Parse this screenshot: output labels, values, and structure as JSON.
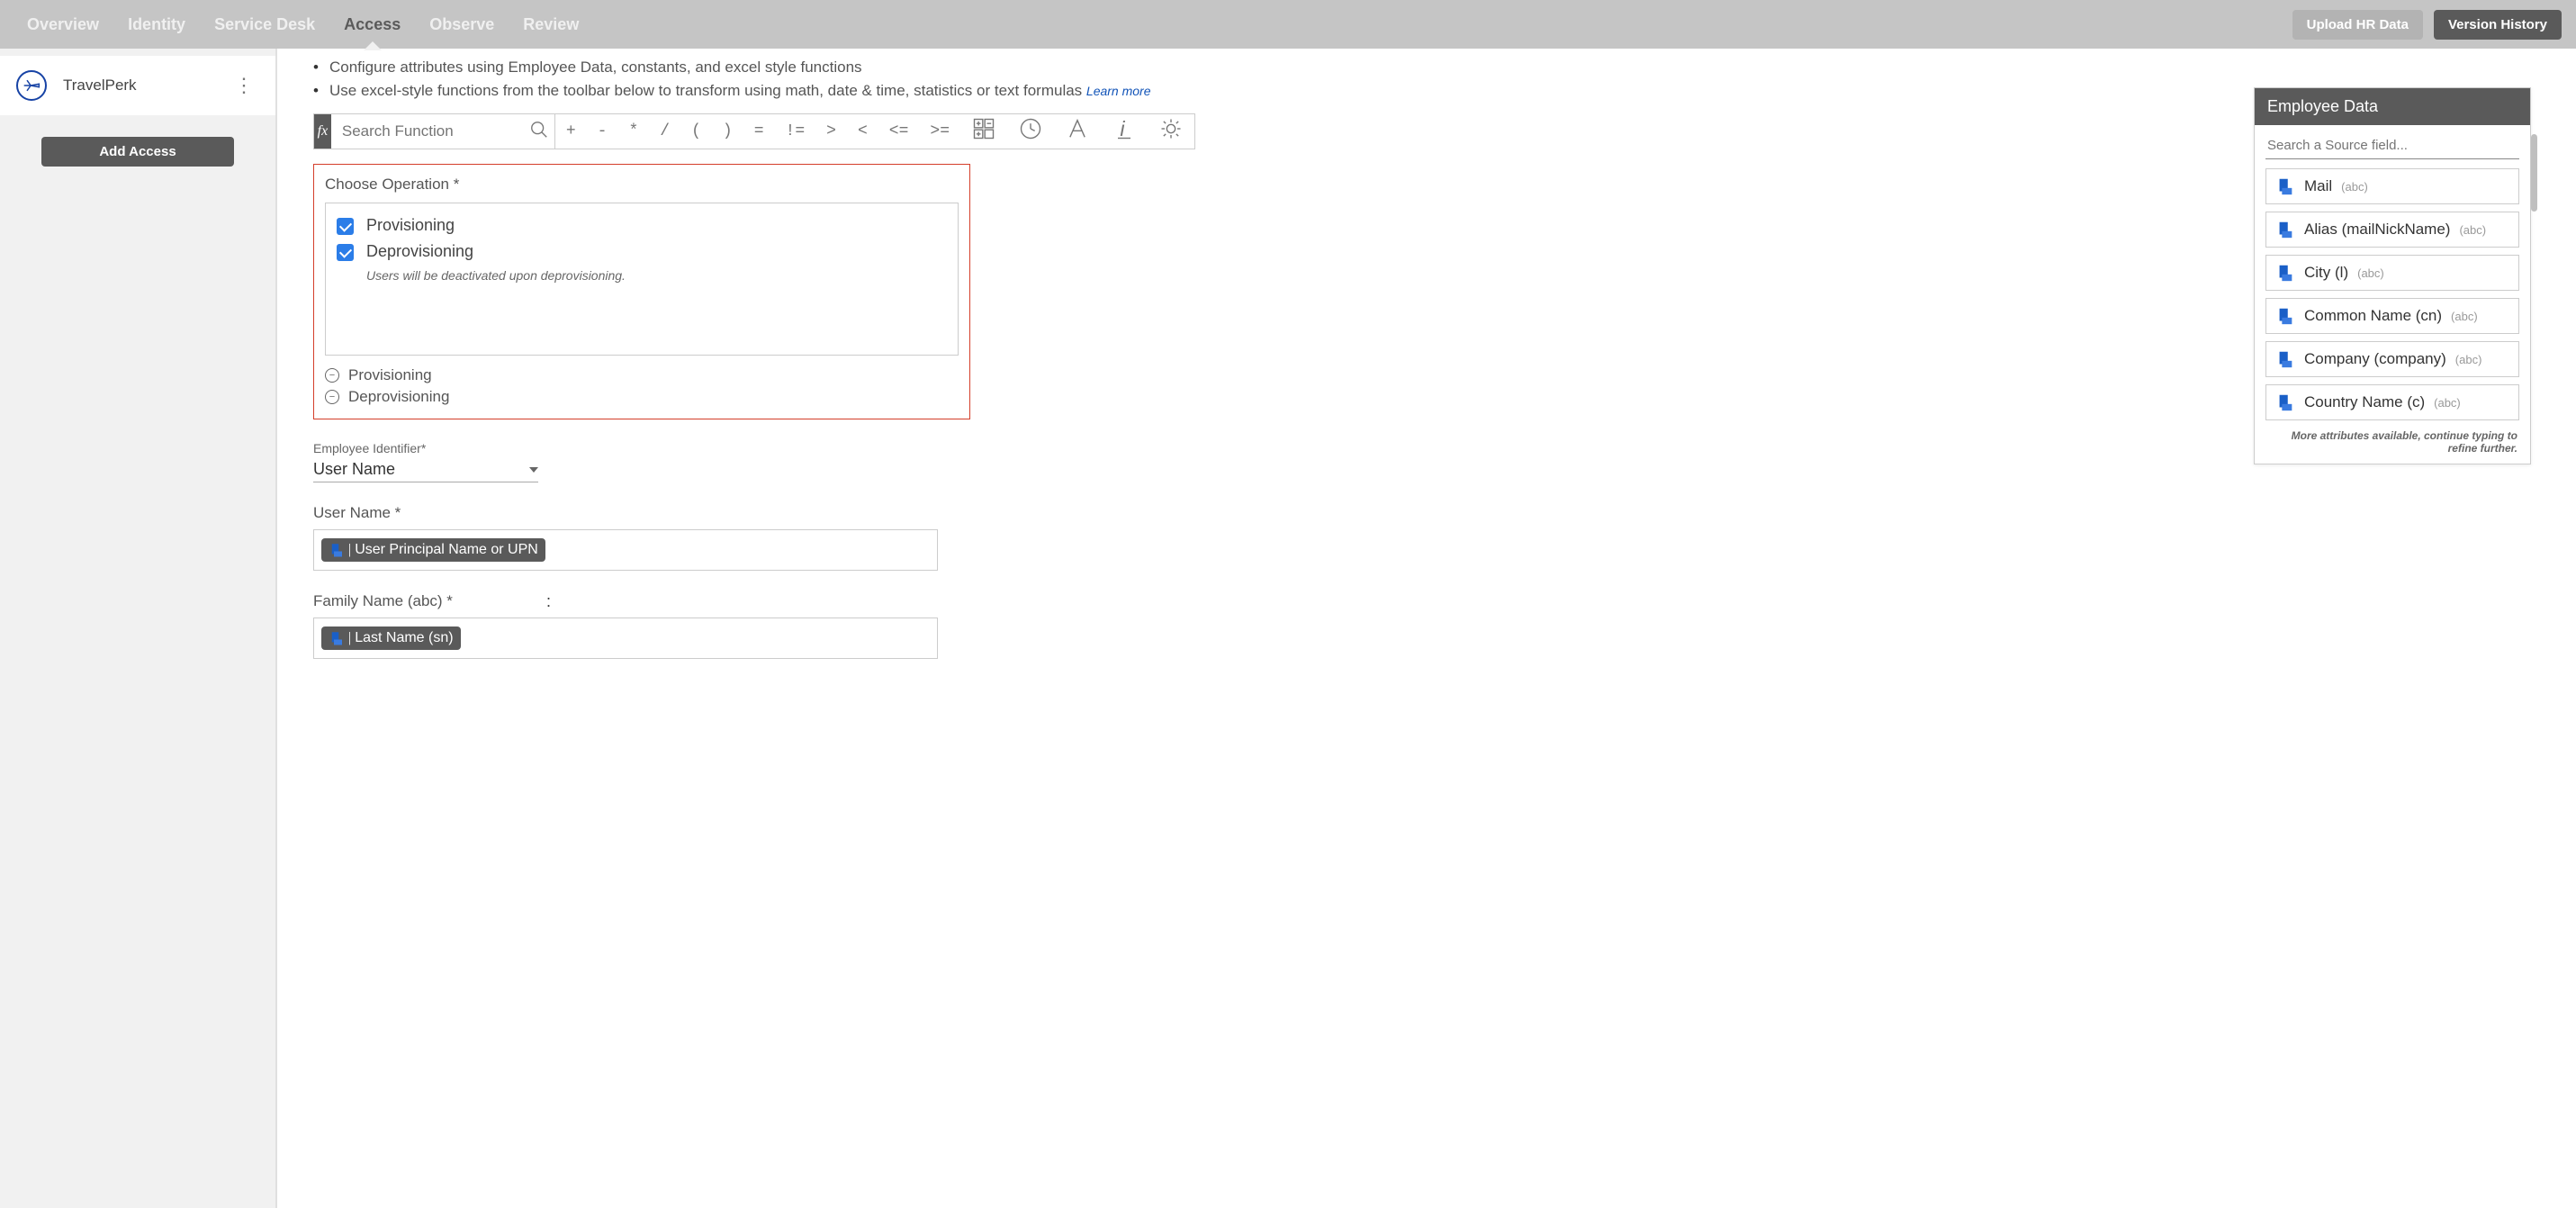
{
  "topnav": {
    "tabs": [
      "Overview",
      "Identity",
      "Service Desk",
      "Access",
      "Observe",
      "Review"
    ],
    "active_tab": "Access",
    "upload_label": "Upload HR Data",
    "version_label": "Version History"
  },
  "sidebar": {
    "app_name": "TravelPerk",
    "add_access_label": "Add Access"
  },
  "main": {
    "bullets": [
      "Configure attributes using Employee Data, constants, and excel style functions",
      "Use excel-style functions from the toolbar below to transform using math, date & time, statistics or text formulas"
    ],
    "learn_more": "Learn more",
    "fx": {
      "symbol": "fx",
      "search_placeholder": "Search Function",
      "ops": [
        "+",
        "-",
        "*",
        "/",
        "(",
        ")",
        "=",
        "!=",
        ">",
        "<",
        "<=",
        ">="
      ]
    },
    "choose_op": {
      "label": "Choose Operation *",
      "items": [
        {
          "label": "Provisioning",
          "checked": true,
          "note": ""
        },
        {
          "label": "Deprovisioning",
          "checked": true,
          "note": "Users will be deactivated upon deprovisioning."
        }
      ],
      "remove": [
        "Provisioning",
        "Deprovisioning"
      ]
    },
    "emp_id": {
      "label": "Employee Identifier*",
      "value": "User Name"
    },
    "username": {
      "label": "User Name *",
      "chip_sep": "|",
      "chip_text": "User Principal Name or UPN"
    },
    "family": {
      "label": "Family Name (abc) *",
      "colon": ":",
      "chip_sep": "|",
      "chip_text": "Last Name (sn)"
    }
  },
  "emp_panel": {
    "header": "Employee Data",
    "search_placeholder": "Search a Source field...",
    "fields": [
      {
        "label": "Mail",
        "type": "(abc)"
      },
      {
        "label": "Alias (mailNickName)",
        "type": "(abc)"
      },
      {
        "label": "City (l)",
        "type": "(abc)"
      },
      {
        "label": "Common Name (cn)",
        "type": "(abc)"
      },
      {
        "label": "Company (company)",
        "type": "(abc)"
      },
      {
        "label": "Country Name (c)",
        "type": "(abc)"
      }
    ],
    "more_note": "More attributes available, continue typing to refine further."
  }
}
